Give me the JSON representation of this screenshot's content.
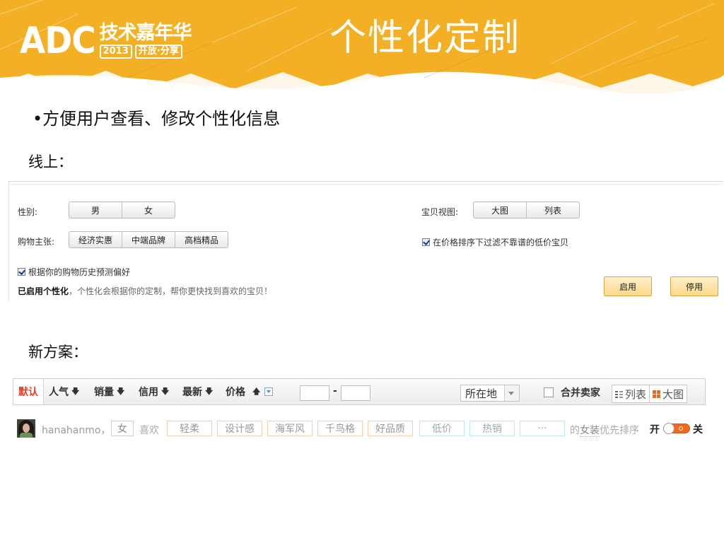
{
  "colors": {
    "banner": "#f4b024",
    "accent_red": "#f03c1e",
    "accent_orange": "#f06a1e",
    "button_yellow": "#fbd98a"
  },
  "header": {
    "logo_main": "ADC",
    "logo_cn": "技术嘉年华",
    "logo_year": "2013",
    "logo_tag": "开放·分享",
    "title": "个性化定制"
  },
  "slide": {
    "bullet": "•方便用户查看、修改个性化信息",
    "section_online": "线上：",
    "section_new": "新方案："
  },
  "settings_panel": {
    "gender_label": "性别:",
    "gender_options": [
      "男",
      "女"
    ],
    "buy_label": "购物主张:",
    "buy_options": [
      "经济实惠",
      "中端品牌",
      "高档精品"
    ],
    "view_label": "宝贝视图:",
    "view_options": [
      "大图",
      "列表"
    ],
    "filter_checkbox": "在价格排序下过滤不靠谱的低价宝贝",
    "history_checkbox": "根据你的购物历史预测偏好",
    "status_strong": "已启用个性化",
    "status_text": "，个性化会根据你的定制，帮你更快找到喜欢的宝贝！",
    "enable_button": "启用",
    "disable_button": "停用"
  },
  "sort_bar": {
    "default": "默认",
    "popularity": "人气",
    "sales": "销量",
    "credit": "信用",
    "newest": "最新",
    "price": "价格",
    "price_dash": "-",
    "location": "所在地",
    "merge_sellers": "合并卖家",
    "view_list": "列表",
    "view_grid": "大图"
  },
  "personal_row": {
    "username": "hanahanmo，",
    "gender": "女",
    "likes_label": "喜欢",
    "style_tags": [
      "轻柔",
      "设计感",
      "海军风",
      "千鸟格",
      "好品质"
    ],
    "sort_tags": [
      "低价",
      "热销",
      "···"
    ],
    "tail_prefix": "的",
    "tail_emph": "女装",
    "tail_suffix": "优先排序",
    "switch_on_label": "开",
    "switch_off_label": "关"
  }
}
